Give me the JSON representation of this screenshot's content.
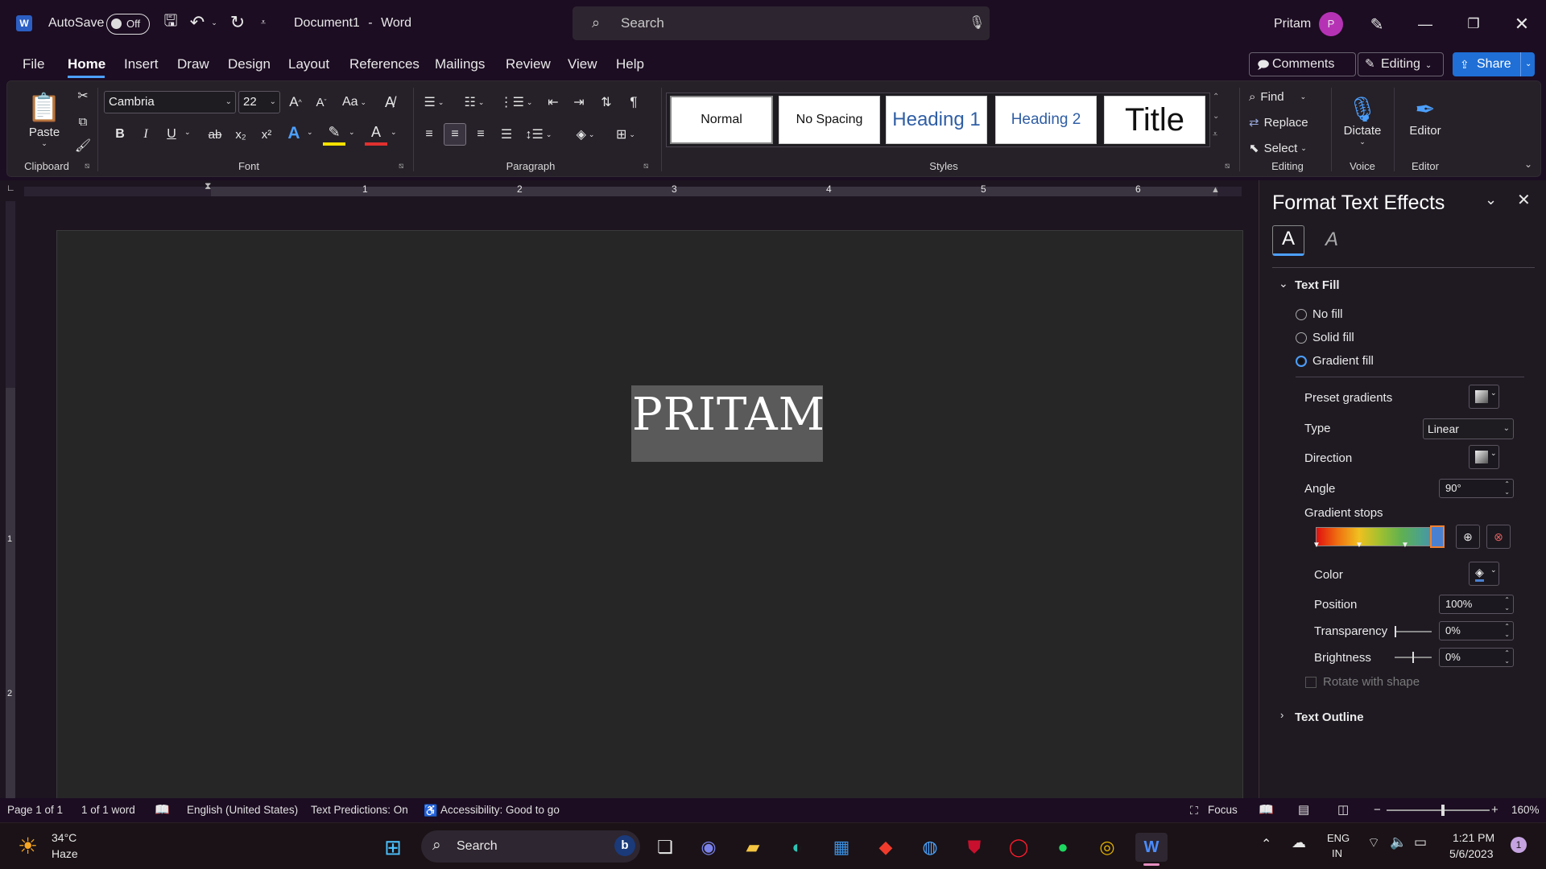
{
  "titlebar": {
    "autosave_label": "AutoSave",
    "autosave_state": "Off",
    "doc_title": "Document1",
    "separator": "-",
    "app_name": "Word",
    "search_placeholder": "Search",
    "user_name": "Pritam",
    "user_initial": "P"
  },
  "menu": {
    "tabs": [
      "File",
      "Home",
      "Insert",
      "Draw",
      "Design",
      "Layout",
      "References",
      "Mailings",
      "Review",
      "View",
      "Help"
    ],
    "active": "Home",
    "comments_label": "Comments",
    "editing_label": "Editing",
    "share_label": "Share"
  },
  "ribbon": {
    "clipboard": {
      "paste_label": "Paste",
      "group_label": "Clipboard"
    },
    "font": {
      "family": "Cambria",
      "size": "22",
      "group_label": "Font",
      "aa_label": "Aa",
      "bold": "B",
      "italic": "I",
      "underline": "U",
      "strike": "ab",
      "sub": "x₂",
      "sup": "x²"
    },
    "paragraph": {
      "group_label": "Paragraph"
    },
    "styles": {
      "group_label": "Styles",
      "items": [
        "Normal",
        "No Spacing",
        "Heading 1",
        "Heading 2",
        "Title"
      ]
    },
    "editing": {
      "find": "Find",
      "replace": "Replace",
      "select": "Select",
      "group_label": "Editing"
    },
    "voice": {
      "dictate": "Dictate",
      "group_label": "Voice"
    },
    "editor": {
      "label": "Editor",
      "group_label": "Editor"
    }
  },
  "ruler": {
    "numbers": [
      "1",
      "2",
      "3",
      "4",
      "5",
      "6"
    ],
    "vnumbers": [
      "1",
      "2"
    ]
  },
  "document": {
    "text": "PRITAM"
  },
  "pane": {
    "title": "Format Text Effects",
    "text_fill_label": "Text Fill",
    "no_fill": "No fill",
    "solid_fill": "Solid fill",
    "gradient_fill": "Gradient fill",
    "selected_fill": "gradient",
    "preset_gradients": "Preset gradients",
    "type_label": "Type",
    "type_value": "Linear",
    "direction_label": "Direction",
    "angle_label": "Angle",
    "angle_value": "90°",
    "gradient_stops_label": "Gradient stops",
    "color_label": "Color",
    "position_label": "Position",
    "position_value": "100%",
    "transparency_label": "Transparency",
    "transparency_value": "0%",
    "brightness_label": "Brightness",
    "brightness_value": "0%",
    "rotate_label": "Rotate with shape",
    "text_outline_label": "Text Outline"
  },
  "gradient_colors": [
    "#e01010",
    "#f07010",
    "#f0c020",
    "#a0c030",
    "#60b050",
    "#4aa090",
    "#4a80d0"
  ],
  "statusbar": {
    "page": "Page 1 of 1",
    "words": "1 of 1 word",
    "language": "English (United States)",
    "predictions": "Text Predictions: On",
    "accessibility": "Accessibility: Good to go",
    "focus": "Focus",
    "zoom": "160%"
  },
  "taskbar": {
    "temp": "34°C",
    "weather": "Haze",
    "search": "Search",
    "lang1": "ENG",
    "lang2": "IN",
    "time": "1:21 PM",
    "date": "5/6/2023",
    "notif_count": "1"
  },
  "colors": {
    "accent": "#4ca0ff",
    "share_bg": "#1f6fd6",
    "avatar": "#b532b5"
  }
}
